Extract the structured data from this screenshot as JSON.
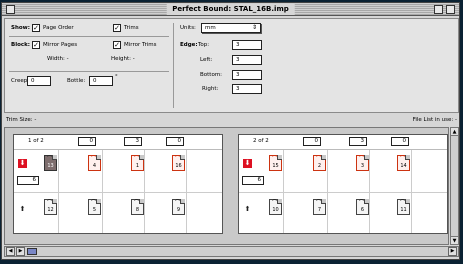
{
  "window": {
    "title": "Perfect Bound: STAL_16B.imp"
  },
  "settings": {
    "show_label": "Show:",
    "page_order_label": "Page Order",
    "trims_label": "Trims",
    "block_label": "Block:",
    "mirror_pages_label": "Mirror Pages",
    "mirror_trims_label": "Mirror Trims",
    "width_label": "Width: -",
    "height_label": "Height: -",
    "creep_label": "Creep:",
    "creep_value": "0",
    "bottle_label": "Bottle:",
    "bottle_value": "0",
    "bottle_unit": "°",
    "units_label": "Units:",
    "units_value": "mm",
    "edge_label": "Edge:",
    "top_label": "Top:",
    "top_value": "3",
    "left_label": "Left:",
    "left_value": "3",
    "bottom_label": "Bottom:",
    "bottom_value": "3",
    "right_label": "Right:",
    "right_value": "3",
    "check_mark": "✓"
  },
  "strip": {
    "trim_size": "Trim Size: -",
    "file_list": "File List in use: -"
  },
  "sheets": [
    {
      "label": "1 of 2",
      "fields": [
        "0",
        "3",
        "0"
      ],
      "gap_value": "6",
      "top_row": [
        {
          "num": "13",
          "style": "selected"
        },
        {
          "num": "4",
          "style": "red"
        },
        {
          "num": "1",
          "style": "red"
        },
        {
          "num": "16",
          "style": "red"
        }
      ],
      "bottom_row": [
        {
          "num": "12",
          "style": "normal"
        },
        {
          "num": "5",
          "style": "normal"
        },
        {
          "num": "8",
          "style": "normal"
        },
        {
          "num": "9",
          "style": "normal"
        }
      ]
    },
    {
      "label": "2 of 2",
      "fields": [
        "0",
        "3",
        "0"
      ],
      "gap_value": "6",
      "top_row": [
        {
          "num": "15",
          "style": "red"
        },
        {
          "num": "2",
          "style": "red"
        },
        {
          "num": "3",
          "style": "red"
        },
        {
          "num": "14",
          "style": "red"
        }
      ],
      "bottom_row": [
        {
          "num": "10",
          "style": "normal"
        },
        {
          "num": "7",
          "style": "normal"
        },
        {
          "num": "6",
          "style": "normal"
        },
        {
          "num": "11",
          "style": "normal"
        }
      ]
    }
  ],
  "icons": {
    "down_arrow": "⬇",
    "up_arrow": "⬆",
    "curl": "⌒",
    "popup_arrow": "⇕",
    "scroll_left": "◀",
    "scroll_right": "▶",
    "scroll_up": "▲",
    "scroll_down": "▼"
  }
}
